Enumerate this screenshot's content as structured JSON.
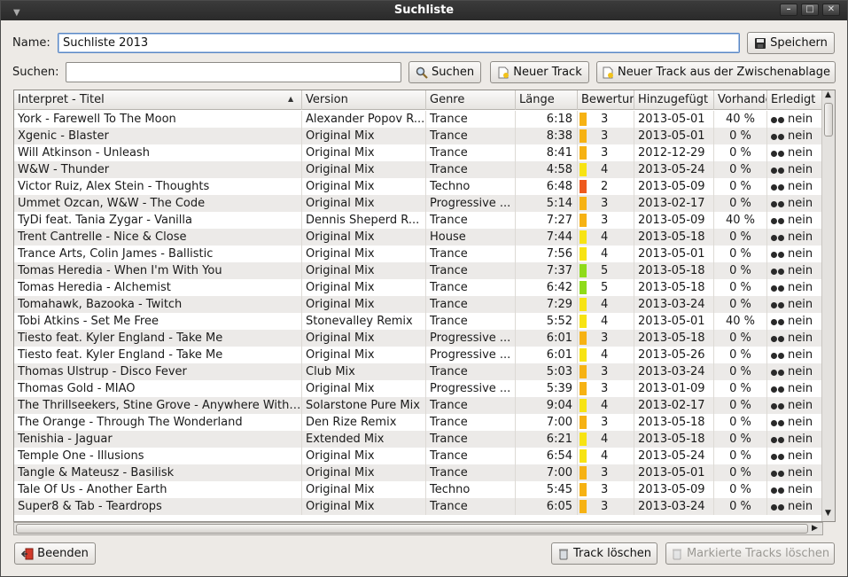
{
  "window": {
    "title": "Suchliste"
  },
  "form": {
    "name_label": "Name:",
    "name_value": "Suchliste 2013",
    "save_label": "Speichern",
    "search_label": "Suchen:",
    "search_value": "",
    "search_button": "Suchen",
    "new_track_button": "Neuer Track",
    "new_from_clipboard_button": "Neuer Track aus der Zwischenablage"
  },
  "table": {
    "columns": [
      "Interpret - Titel",
      "Version",
      "Genre",
      "Länge",
      "Bewertung",
      "Hinzugefügt",
      "Vorhanden",
      "Erledigt"
    ],
    "rows": [
      [
        "York - Farewell To The Moon",
        "Alexander Popov R...",
        "Trance",
        "6:18",
        "3",
        "2013-05-01",
        "40 %",
        "nein"
      ],
      [
        "Xgenic - Blaster",
        "Original Mix",
        "Trance",
        "8:38",
        "3",
        "2013-05-01",
        "0 %",
        "nein"
      ],
      [
        "Will Atkinson - Unleash",
        "Original Mix",
        "Trance",
        "8:41",
        "3",
        "2012-12-29",
        "0 %",
        "nein"
      ],
      [
        "W&W - Thunder",
        "Original Mix",
        "Trance",
        "4:58",
        "4",
        "2013-05-24",
        "0 %",
        "nein"
      ],
      [
        "Victor Ruiz, Alex Stein - Thoughts",
        "Original Mix",
        "Techno",
        "6:48",
        "2",
        "2013-05-09",
        "0 %",
        "nein"
      ],
      [
        "Ummet Ozcan, W&W - The Code",
        "Original Mix",
        "Progressive ...",
        "5:14",
        "3",
        "2013-02-17",
        "0 %",
        "nein"
      ],
      [
        "TyDi feat. Tania Zygar - Vanilla",
        "Dennis Sheperd R...",
        "Trance",
        "7:27",
        "3",
        "2013-05-09",
        "40 %",
        "nein"
      ],
      [
        "Trent Cantrelle - Nice & Close",
        "Original Mix",
        "House",
        "7:44",
        "4",
        "2013-05-18",
        "0 %",
        "nein"
      ],
      [
        "Trance Arts, Colin James - Ballistic",
        "Original Mix",
        "Trance",
        "7:56",
        "4",
        "2013-05-01",
        "0 %",
        "nein"
      ],
      [
        "Tomas Heredia - When I'm With You",
        "Original Mix",
        "Trance",
        "7:37",
        "5",
        "2013-05-18",
        "0 %",
        "nein"
      ],
      [
        "Tomas Heredia - Alchemist",
        "Original Mix",
        "Trance",
        "6:42",
        "5",
        "2013-05-18",
        "0 %",
        "nein"
      ],
      [
        "Tomahawk, Bazooka - Twitch",
        "Original Mix",
        "Trance",
        "7:29",
        "4",
        "2013-03-24",
        "0 %",
        "nein"
      ],
      [
        "Tobi Atkins - Set Me Free",
        "Stonevalley Remix",
        "Trance",
        "5:52",
        "4",
        "2013-05-01",
        "40 %",
        "nein"
      ],
      [
        "Tiesto feat. Kyler England - Take Me",
        "Original Mix",
        "Progressive ...",
        "6:01",
        "3",
        "2013-05-18",
        "0 %",
        "nein"
      ],
      [
        "Tiesto feat. Kyler England - Take Me",
        "Original Mix",
        "Progressive ...",
        "6:01",
        "4",
        "2013-05-26",
        "0 %",
        "nein"
      ],
      [
        "Thomas Ulstrup - Disco Fever",
        "Club Mix",
        "Trance",
        "5:03",
        "3",
        "2013-03-24",
        "0 %",
        "nein"
      ],
      [
        "Thomas Gold - MIAO",
        "Original Mix",
        "Progressive ...",
        "5:39",
        "3",
        "2013-01-09",
        "0 %",
        "nein"
      ],
      [
        "The Thrillseekers, Stine Grove - Anywhere With Y...",
        "Solarstone Pure Mix",
        "Trance",
        "9:04",
        "4",
        "2013-02-17",
        "0 %",
        "nein"
      ],
      [
        "The Orange - Through The Wonderland",
        "Den Rize Remix",
        "Trance",
        "7:00",
        "3",
        "2013-05-18",
        "0 %",
        "nein"
      ],
      [
        "Tenishia - Jaguar",
        "Extended Mix",
        "Trance",
        "6:21",
        "4",
        "2013-05-18",
        "0 %",
        "nein"
      ],
      [
        "Temple One - Illusions",
        "Original Mix",
        "Trance",
        "6:54",
        "4",
        "2013-05-24",
        "0 %",
        "nein"
      ],
      [
        "Tangle & Mateusz - Basilisk",
        "Original Mix",
        "Trance",
        "7:00",
        "3",
        "2013-05-01",
        "0 %",
        "nein"
      ],
      [
        "Tale Of Us - Another Earth",
        "Original Mix",
        "Techno",
        "5:45",
        "3",
        "2013-05-09",
        "0 %",
        "nein"
      ],
      [
        "Super8 & Tab - Teardrops",
        "Original Mix",
        "Trance",
        "6:05",
        "3",
        "2013-03-24",
        "0 %",
        "nein"
      ]
    ]
  },
  "rating_colors": {
    "2": "#ee5a1e",
    "3": "#f6b213",
    "4": "#f7e313",
    "5": "#8fdb1a"
  },
  "footer": {
    "quit_button": "Beenden",
    "delete_track_button": "Track löschen",
    "delete_marked_button": "Markierte Tracks löschen"
  }
}
